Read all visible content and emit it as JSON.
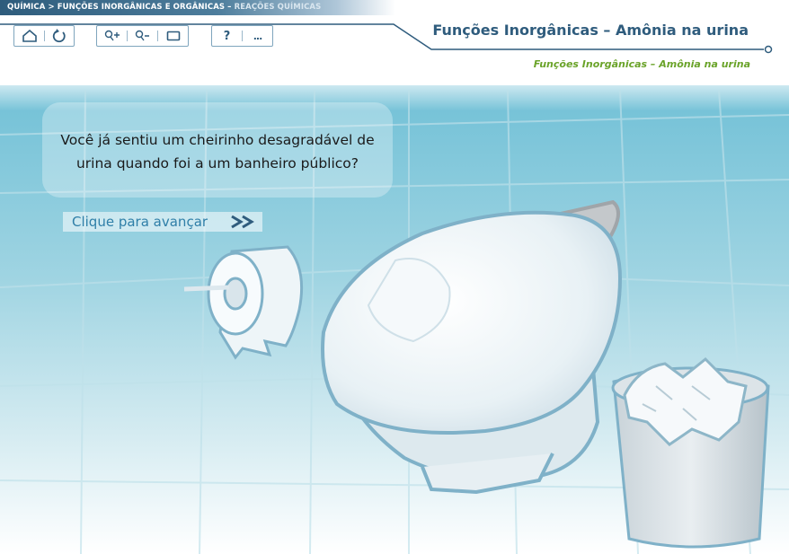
{
  "breadcrumb": {
    "path": "QUÍMICA > FUNÇÕES INORGÂNICAS E ORGÂNICAS –",
    "current": " REAÇÕES QUÍMICAS"
  },
  "header": {
    "title": "Funções Inorgânicas – Amônia na urina",
    "subtitle": "Funções Inorgânicas – Amônia na urina"
  },
  "toolbar": {
    "help_label": "?",
    "more_label": "..."
  },
  "content": {
    "question": "Você já sentiu um cheirinho desagradável de urina quando foi a um banheiro público?",
    "advance_label": "Clique para avançar"
  },
  "colors": {
    "accent": "#2f5c7d",
    "subtitle": "#6aa329",
    "wall": "#7cc4d8"
  }
}
